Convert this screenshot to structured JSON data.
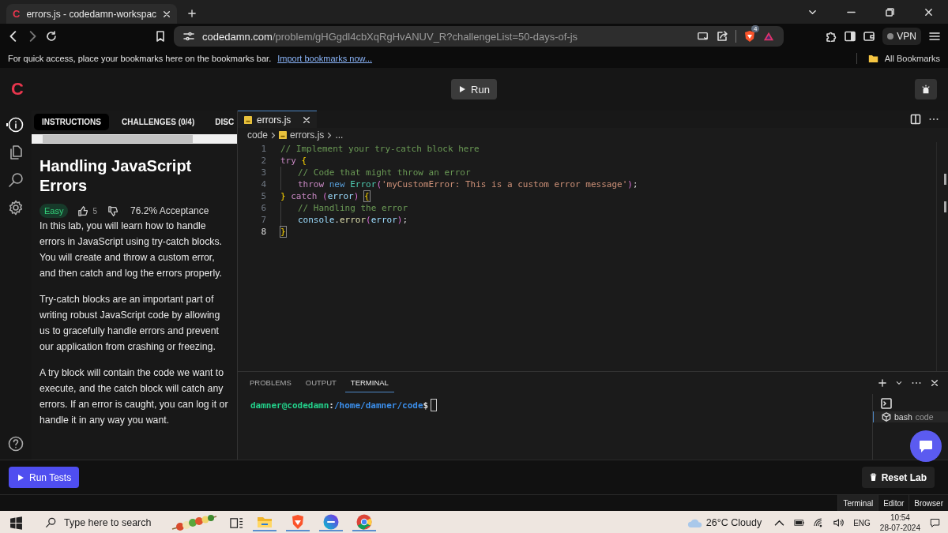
{
  "browser": {
    "favicon": "C",
    "tab_title": "errors.js - codedamn-workspac",
    "url_host": "codedamn.com",
    "url_path": "/problem/gHGgdl4cbXqRgHvANUV_R?challengeList=50-days-of-js",
    "shields_count": "4",
    "vpn_label": "VPN"
  },
  "bookmarks_bar": {
    "message": "For quick access, place your bookmarks here on the bookmarks bar.",
    "link": "Import bookmarks now...",
    "all_bookmarks": "All Bookmarks"
  },
  "header": {
    "logo": "C",
    "run_button": "Run"
  },
  "activity_bar": [
    {
      "kind": "info",
      "selected": true
    },
    {
      "kind": "files",
      "selected": false
    },
    {
      "kind": "search",
      "selected": false
    },
    {
      "kind": "settings",
      "selected": false
    }
  ],
  "instructions": {
    "tabs": [
      {
        "label": "INSTRUCTIONS",
        "selected": true
      },
      {
        "label": "CHALLENGES (0/4)",
        "selected": false
      },
      {
        "label": "DISC",
        "selected": false
      }
    ],
    "title": "Handling JavaScript Errors",
    "difficulty": "Easy",
    "likes": "5",
    "acceptance": "76.2% Acceptance",
    "paragraphs": [
      "In this lab, you will learn how to handle errors in JavaScript using try-catch blocks. You will create and throw a custom error, and then catch and log the errors properly.",
      "Try-catch blocks are an important part of writing robust JavaScript code by allowing us to gracefully handle errors and prevent our application from crashing or freezing.",
      "A try block will contain the code we want to execute, and the catch block will catch any errors. If an error is caught, you can log it or handle it in any way you want."
    ]
  },
  "editor": {
    "tabs": [
      {
        "label": "errors.js",
        "selected": true
      }
    ],
    "breadcrumb": [
      "code",
      "errors.js",
      "..."
    ],
    "lines": [
      {
        "number": "1",
        "active": false,
        "indent": false,
        "tokens": [
          {
            "text": "// Implement your try-catch block here",
            "kind": "comment"
          }
        ]
      },
      {
        "number": "2",
        "active": false,
        "indent": false,
        "tokens": [
          {
            "text": "try ",
            "kind": "keyword"
          },
          {
            "text": "{",
            "kind": "bracket"
          }
        ]
      },
      {
        "number": "3",
        "active": false,
        "indent": true,
        "tokens": [
          {
            "text": "// Code that might throw an error",
            "kind": "comment"
          }
        ]
      },
      {
        "number": "4",
        "active": false,
        "indent": true,
        "tokens": [
          {
            "text": "throw ",
            "kind": "keyword"
          },
          {
            "text": "new ",
            "kind": "storage"
          },
          {
            "text": "Error",
            "kind": "type"
          },
          {
            "text": "(",
            "kind": "paren"
          },
          {
            "text": "'myCustomError: This is a custom error message'",
            "kind": "string"
          },
          {
            "text": ")",
            "kind": "paren"
          },
          {
            "text": ";",
            "kind": "plain"
          }
        ]
      },
      {
        "number": "5",
        "active": false,
        "indent": false,
        "tokens": [
          {
            "text": "} ",
            "kind": "bracket"
          },
          {
            "text": "catch ",
            "kind": "keyword"
          },
          {
            "text": "(",
            "kind": "paren"
          },
          {
            "text": "error",
            "kind": "variable"
          },
          {
            "text": ") ",
            "kind": "paren"
          },
          {
            "text": "{",
            "kind": "match"
          }
        ]
      },
      {
        "number": "6",
        "active": false,
        "indent": true,
        "tokens": [
          {
            "text": "// Handling the error",
            "kind": "comment"
          }
        ]
      },
      {
        "number": "7",
        "active": false,
        "indent": true,
        "tokens": [
          {
            "text": "console",
            "kind": "variable"
          },
          {
            "text": ".",
            "kind": "plain"
          },
          {
            "text": "error",
            "kind": "function"
          },
          {
            "text": "(",
            "kind": "paren"
          },
          {
            "text": "error",
            "kind": "variable"
          },
          {
            "text": ")",
            "kind": "paren"
          },
          {
            "text": ";",
            "kind": "plain"
          }
        ]
      },
      {
        "number": "8",
        "active": true,
        "indent": false,
        "tokens": [
          {
            "text": "}",
            "kind": "match"
          }
        ]
      }
    ]
  },
  "terminal": {
    "tabs": [
      {
        "label": "PROBLEMS",
        "selected": false
      },
      {
        "label": "OUTPUT",
        "selected": false
      },
      {
        "label": "TERMINAL",
        "selected": true
      }
    ],
    "prompt": [
      {
        "text": "damner@codedamn",
        "kind": "user"
      },
      {
        "text": ":",
        "kind": "plain"
      },
      {
        "text": "/home/damner/code",
        "kind": "path"
      },
      {
        "text": "$",
        "kind": "plain"
      }
    ],
    "sessions": [
      {
        "name": "bash",
        "folder": "code",
        "selected": true
      }
    ]
  },
  "footer": {
    "run_tests": "Run Tests",
    "reset": "Reset Lab"
  },
  "view_tabs": [
    {
      "label": "Terminal",
      "selected": true
    },
    {
      "label": "Editor",
      "selected": false
    },
    {
      "label": "Browser",
      "selected": false
    }
  ],
  "taskbar": {
    "search_placeholder": "Type here to search",
    "weather": "26°C Cloudy",
    "language": "ENG",
    "time": "10:54",
    "date": "28-07-2024"
  }
}
